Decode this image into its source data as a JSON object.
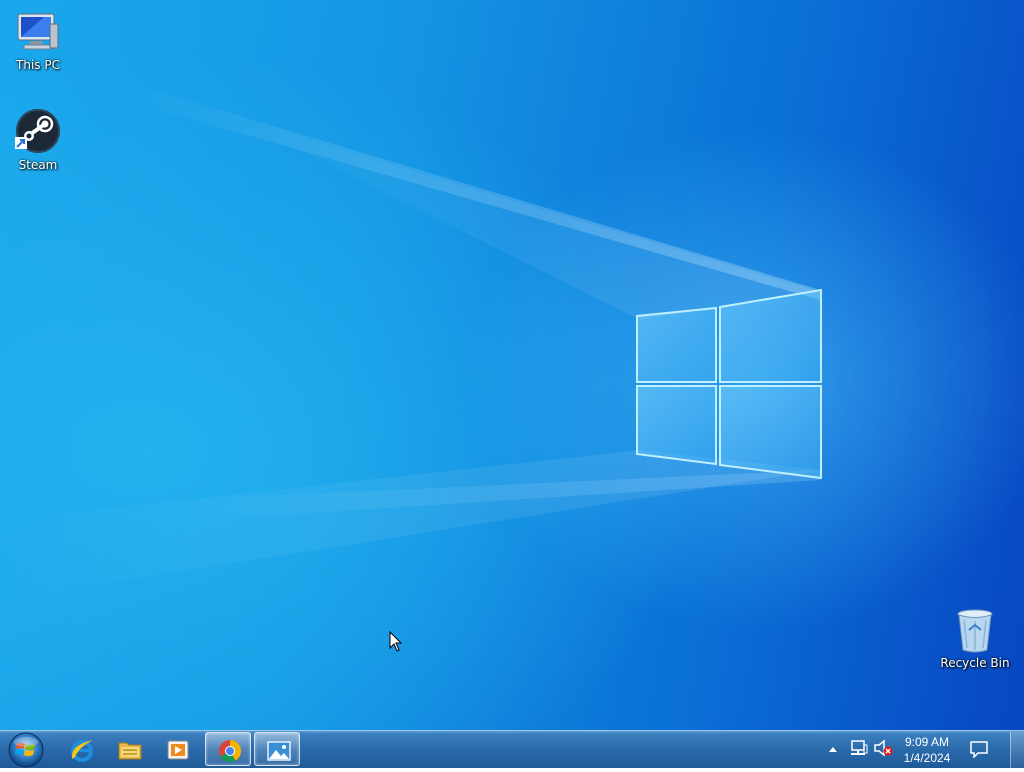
{
  "desktop": {
    "icons": [
      {
        "label": "This PC"
      },
      {
        "label": "Steam"
      },
      {
        "label": "Recycle Bin"
      }
    ]
  },
  "taskbar": {
    "start_icon": "windows-orb-icon",
    "pinned": [
      {
        "icon": "internet-explorer-icon"
      },
      {
        "icon": "file-explorer-icon"
      },
      {
        "icon": "media-player-icon"
      },
      {
        "icon": "chrome-icon"
      },
      {
        "icon": "photos-icon"
      }
    ]
  },
  "tray": {
    "time": "9:09 AM",
    "date": "1/4/2024",
    "icons": [
      "show-hidden-icons-arrow",
      "network-icon",
      "volume-muted-icon",
      "action-center-icon"
    ]
  },
  "colors": {
    "desktop_left": "#1aa8ec",
    "desktop_right": "#0846c2",
    "taskbar": "#2a6aab"
  }
}
